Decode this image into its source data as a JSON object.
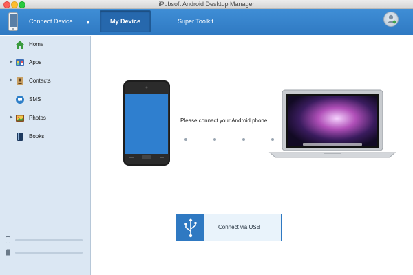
{
  "window": {
    "title": "iPubsoft Android Desktop Manager"
  },
  "toolbar": {
    "connect_label": "Connect Device",
    "tabs": [
      {
        "label": "My Device",
        "active": true
      },
      {
        "label": "Super Toolkit",
        "active": false
      }
    ],
    "accent_color": "#2f79c2"
  },
  "sidebar": {
    "items": [
      {
        "label": "Home",
        "icon": "home-icon",
        "expandable": false
      },
      {
        "label": "Apps",
        "icon": "apps-icon",
        "expandable": true
      },
      {
        "label": "Contacts",
        "icon": "contacts-icon",
        "expandable": true
      },
      {
        "label": "SMS",
        "icon": "sms-icon",
        "expandable": false
      },
      {
        "label": "Photos",
        "icon": "photos-icon",
        "expandable": true
      },
      {
        "label": "Books",
        "icon": "books-icon",
        "expandable": false
      }
    ]
  },
  "main": {
    "prompt": "Please connect your Android phone",
    "usb_button_label": "Connect via USB"
  }
}
